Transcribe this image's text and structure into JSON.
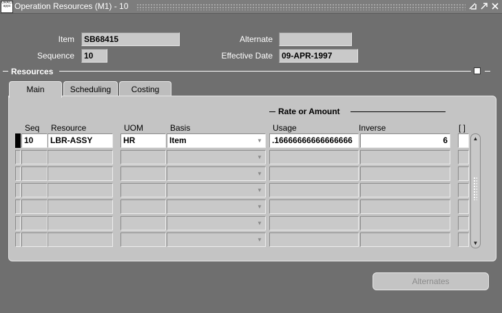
{
  "window": {
    "title": "Operation Resources (M1) - 10",
    "icon_text": "ORACLE apps",
    "controls": [
      "minimize",
      "maximize",
      "close"
    ]
  },
  "header": {
    "item_label": "Item",
    "item_value": "SB68415",
    "sequence_label": "Sequence",
    "sequence_value": "10",
    "alternate_label": "Alternate",
    "alternate_value": "",
    "effective_date_label": "Effective Date",
    "effective_date_value": "09-APR-1997"
  },
  "section": {
    "title": "Resources"
  },
  "tabs": [
    {
      "label": "Main",
      "active": true
    },
    {
      "label": "Scheduling",
      "active": false
    },
    {
      "label": "Costing",
      "active": false
    }
  ],
  "group": {
    "rate_label": "Rate or Amount"
  },
  "columns": {
    "seq": "Seq",
    "resource": "Resource",
    "uom": "UOM",
    "basis": "Basis",
    "usage": "Usage",
    "inverse": "Inverse",
    "flex": "[ ]"
  },
  "rows": [
    {
      "seq": "10",
      "resource": "LBR-ASSY",
      "uom": "HR",
      "basis": "Item",
      "usage": ".16666666666666666",
      "inverse": "6"
    },
    {
      "seq": "",
      "resource": "",
      "uom": "",
      "basis": "",
      "usage": "",
      "inverse": ""
    },
    {
      "seq": "",
      "resource": "",
      "uom": "",
      "basis": "",
      "usage": "",
      "inverse": ""
    },
    {
      "seq": "",
      "resource": "",
      "uom": "",
      "basis": "",
      "usage": "",
      "inverse": ""
    },
    {
      "seq": "",
      "resource": "",
      "uom": "",
      "basis": "",
      "usage": "",
      "inverse": ""
    },
    {
      "seq": "",
      "resource": "",
      "uom": "",
      "basis": "",
      "usage": "",
      "inverse": ""
    },
    {
      "seq": "",
      "resource": "",
      "uom": "",
      "basis": "",
      "usage": "",
      "inverse": ""
    }
  ],
  "buttons": {
    "alternates": "Alternates"
  },
  "colors": {
    "background": "#6f6f6f",
    "panel": "#c4c4c4",
    "field": "#c9c9c9",
    "active_field": "#ffffff"
  }
}
